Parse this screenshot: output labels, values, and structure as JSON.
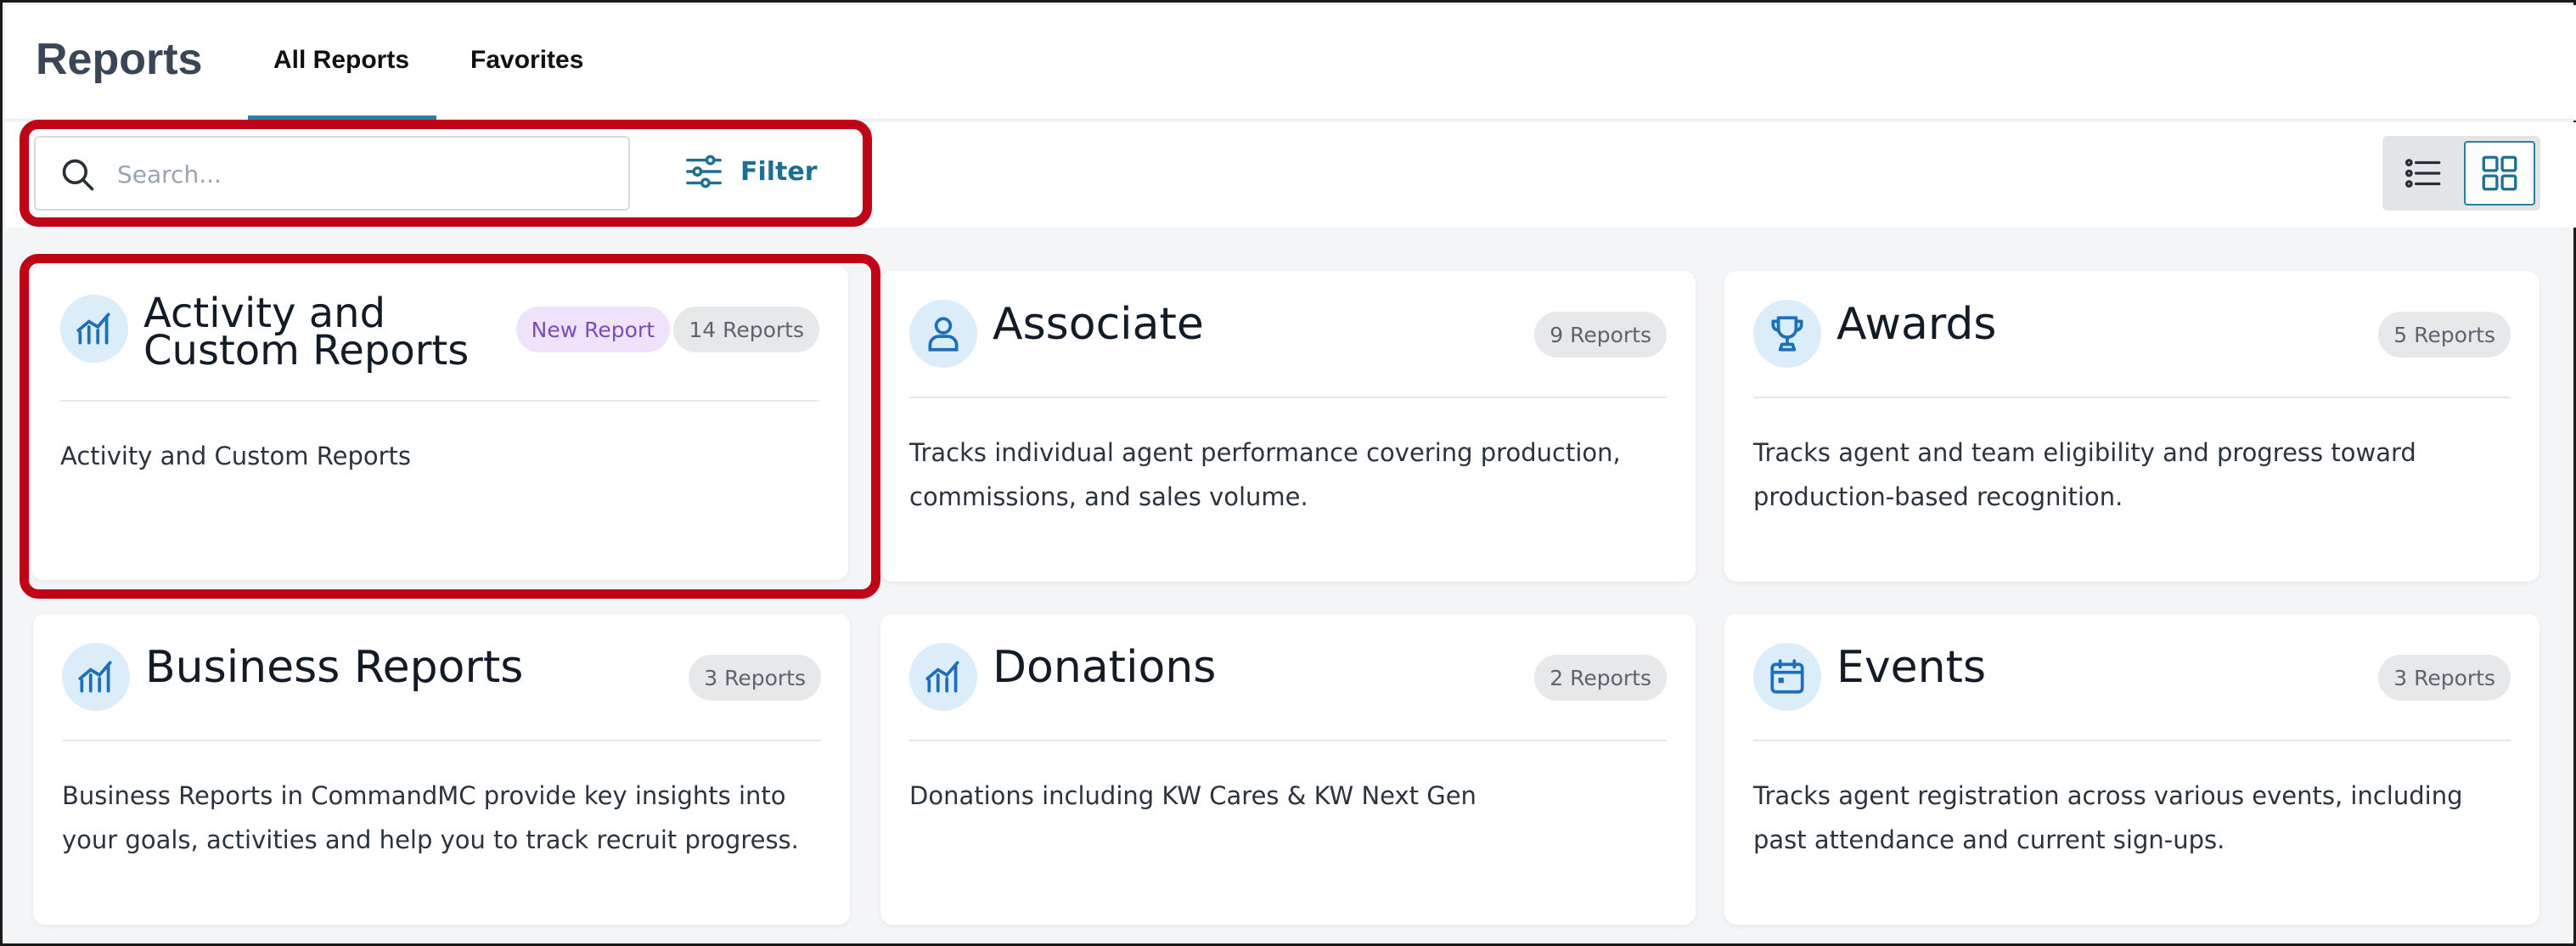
{
  "header": {
    "title": "Reports",
    "tabs": [
      {
        "label": "All Reports",
        "active": true
      },
      {
        "label": "Favorites",
        "active": false
      }
    ]
  },
  "toolbar": {
    "search_placeholder": "Search...",
    "filter_label": "Filter",
    "view_modes": [
      "list-view",
      "grid-view"
    ],
    "active_view": "grid-view"
  },
  "colors": {
    "accent": "#1d6f93",
    "highlight": "#c00418",
    "new_badge_bg": "#efe3fb",
    "new_badge_text": "#7b4bb8"
  },
  "cards": [
    {
      "title": "Activity and Custom Reports",
      "icon": "bar-chart-icon",
      "new_badge": "New Report",
      "count": "14 Reports",
      "description": "Activity and Custom Reports"
    },
    {
      "title": "Associate",
      "icon": "person-icon",
      "count": "9 Reports",
      "description": "Tracks individual agent performance covering production, commissions, and sales volume."
    },
    {
      "title": "Awards",
      "icon": "trophy-icon",
      "count": "5 Reports",
      "description": "Tracks agent and team eligibility and progress toward production-based recognition."
    },
    {
      "title": "Business Reports",
      "icon": "bar-chart-icon",
      "count": "3 Reports",
      "description": "Business Reports in CommandMC provide key insights into your goals, activities and help you to track recruit progress."
    },
    {
      "title": "Donations",
      "icon": "bar-chart-icon",
      "count": "2 Reports",
      "description": "Donations including KW Cares & KW Next Gen"
    },
    {
      "title": "Events",
      "icon": "calendar-icon",
      "count": "3 Reports",
      "description": "Tracks agent registration across various events, including past attendance and current sign-ups."
    }
  ]
}
